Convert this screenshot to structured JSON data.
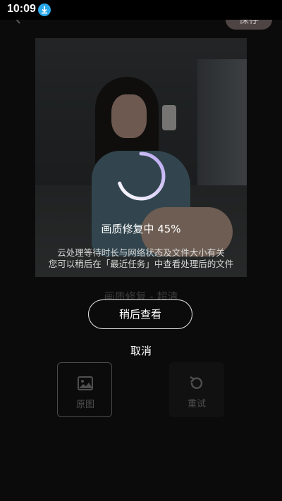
{
  "status_bar": {
    "time": "10:09"
  },
  "header": {
    "save_label": "保存"
  },
  "processing": {
    "status_text": "画质修复中 45%",
    "progress": 0.45,
    "info_line_1": "云处理等待时长与网络状态及文件大小有关",
    "info_line_2": "您可以稍后在「最近任务」中查看处理后的文件"
  },
  "quality_label": "画质修复 - 超清",
  "actions": {
    "later_label": "稍后查看",
    "cancel_label": "取消"
  },
  "tools": [
    {
      "label": "原图",
      "icon": "image-icon"
    },
    {
      "label": "重试",
      "icon": "retry-icon"
    }
  ],
  "colors": {
    "accent": "#2aa7e8",
    "ring_start": "#ffffff",
    "ring_end": "#b9a6f2"
  }
}
